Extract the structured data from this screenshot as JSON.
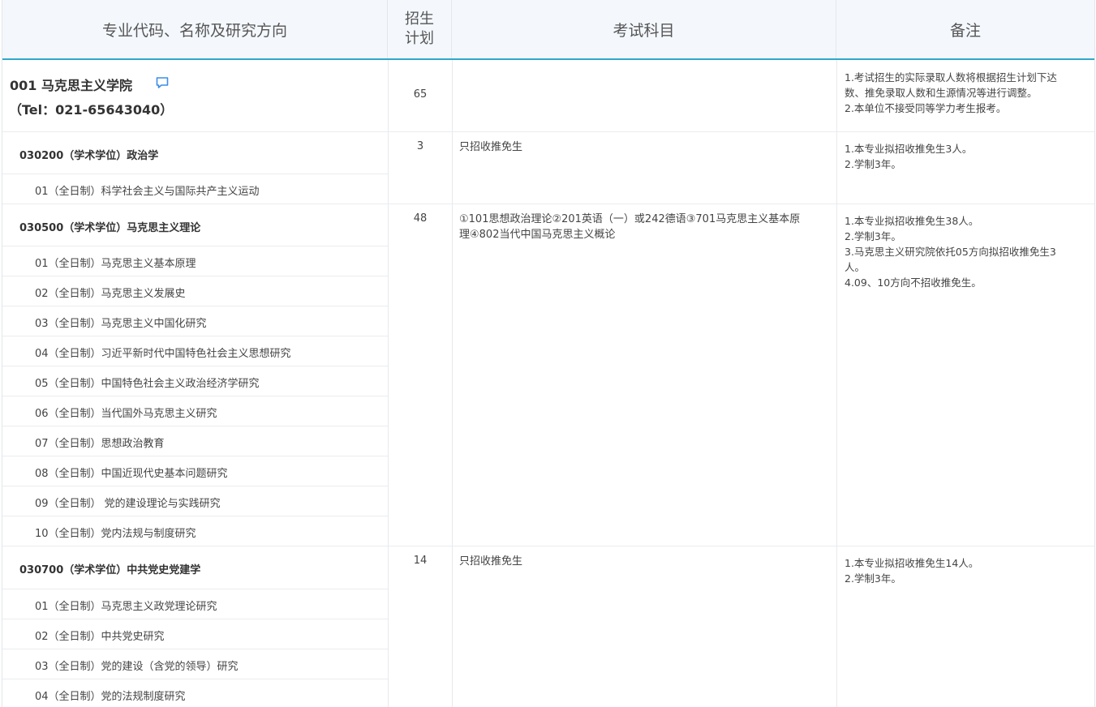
{
  "header": {
    "col1": "专业代码、名称及研究方向",
    "col2_line1": "招生",
    "col2_line2": "计划",
    "col3": "考试科目",
    "col4": "备注"
  },
  "department": {
    "name": "001 马克思主义学院",
    "tel": "（Tel：021-65643040）",
    "plan": "65",
    "notes": [
      "1.考试招生的实际录取人数将根据招生计划下达",
      "数、推免录取人数和生源情况等进行调整。",
      "2.本单位不接受同等学力考生报考。"
    ]
  },
  "majors": [
    {
      "title": "030200（学术学位）政治学",
      "plan": "3",
      "exam": [
        "只招收推免生"
      ],
      "notes": [
        "1.本专业拟招收推免生3人。",
        "2.学制3年。"
      ],
      "directions": [
        "01（全日制）科学社会主义与国际共产主义运动"
      ]
    },
    {
      "title": "030500（学术学位）马克思主义理论",
      "plan": "48",
      "exam": [
        "①101思想政治理论②201英语（一）或242德语③701马克思主义基本原",
        "理④802当代中国马克思主义概论"
      ],
      "notes": [
        "1.本专业拟招收推免生38人。",
        "2.学制3年。",
        "3.马克思主义研究院依托05方向拟招收推免生3",
        "人。",
        "4.09、10方向不招收推免生。"
      ],
      "directions": [
        "01（全日制）马克思主义基本原理",
        "02（全日制）马克思主义发展史",
        "03（全日制）马克思主义中国化研究",
        "04（全日制）习近平新时代中国特色社会主义思想研究",
        "05（全日制）中国特色社会主义政治经济学研究",
        "06（全日制）当代国外马克思主义研究",
        "07（全日制）思想政治教育",
        "08（全日制）中国近现代史基本问题研究",
        "09（全日制） 党的建设理论与实践研究",
        "10（全日制）党内法规与制度研究"
      ]
    },
    {
      "title": "030700（学术学位）中共党史党建学",
      "plan": "14",
      "exam": [
        "只招收推免生"
      ],
      "notes": [
        "1.本专业拟招收推免生14人。",
        "2.学制3年。"
      ],
      "directions": [
        "01（全日制）马克思主义政党理论研究",
        "02（全日制）中共党史研究",
        "03（全日制）党的建设（含党的领导）研究",
        "04（全日制）党的法规制度研究"
      ]
    }
  ],
  "colors": {
    "accent": "#2fa8c8",
    "header_bg": "#f4f8fd",
    "comment_icon": "#3a8ee6"
  }
}
